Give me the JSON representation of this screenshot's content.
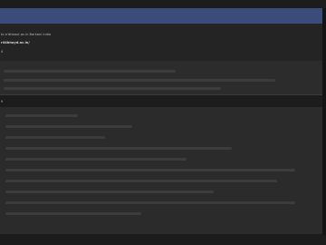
{
  "header": {
    "line1": "to e'dhbaut.ac.in Barkani india",
    "line2": "r44bhoyd.ac.in/",
    "line3": "4"
  },
  "section": {
    "marker": "9"
  },
  "colors": {
    "title_bar": "#3b4c7a",
    "background": "#1c1c1c",
    "panel": "#2b2b2b"
  }
}
